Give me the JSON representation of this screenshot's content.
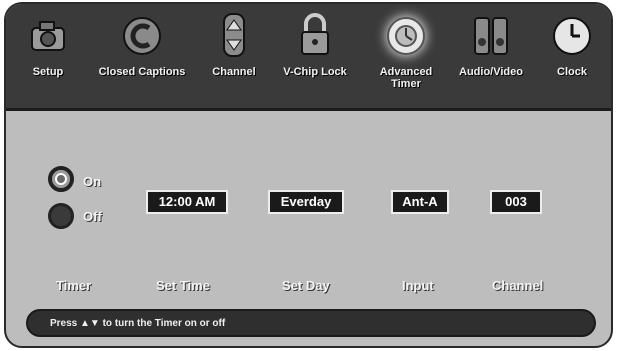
{
  "menu": [
    {
      "label": "Setup",
      "icon": "camera-icon"
    },
    {
      "label": "Closed Captions",
      "icon": "captions-icon"
    },
    {
      "label": "Channel",
      "icon": "channel-arrows-icon"
    },
    {
      "label": "V-Chip Lock",
      "icon": "lock-icon"
    },
    {
      "label": "Advanced\nTimer",
      "icon": "advanced-timer-icon"
    },
    {
      "label": "Audio/Video",
      "icon": "audio-video-icon"
    },
    {
      "label": "Clock",
      "icon": "clock-icon"
    }
  ],
  "timer": {
    "label": "Timer",
    "on_label": "On",
    "off_label": "Off",
    "selected": "On"
  },
  "set_time": {
    "label": "Set Time",
    "value": "12:00 AM"
  },
  "set_day": {
    "label": "Set Day",
    "value": "Everday"
  },
  "input": {
    "label": "Input",
    "value": "Ant-A"
  },
  "channel": {
    "label": "Channel",
    "value": "003"
  },
  "status": {
    "text": "Press ▲▼ to turn the Timer on or off"
  }
}
